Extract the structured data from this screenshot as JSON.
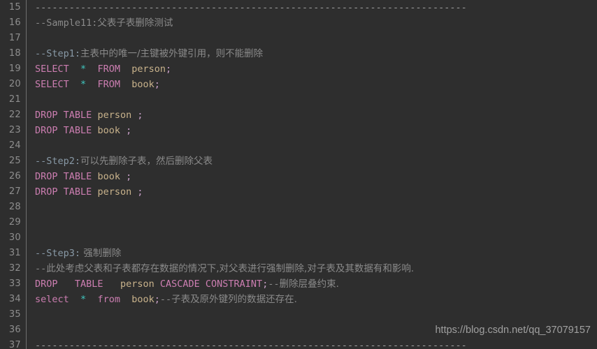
{
  "editor": {
    "theme": {
      "background": "#2e2e2e",
      "gutter_text": "#8e8e8e",
      "gutter_rule": "#6f6f6f",
      "default_text": "#a9b7c6",
      "keyword": "#cc7eb1",
      "identifier": "#c9b38c",
      "operator": "#40c8c0",
      "punctuation": "#c8a0c8",
      "comment": "#8a8a8a",
      "comment_label": "#8899a6"
    },
    "first_line_number": 15,
    "lines": [
      {
        "num": "15",
        "tokens": [
          {
            "cls": "dash",
            "t": "----------------------------------------------------------------------------"
          }
        ]
      },
      {
        "num": "16",
        "tokens": [
          {
            "cls": "cmt",
            "t": "--Sample11:"
          },
          {
            "cls": "cmt cjk",
            "t": "父表子表删除测试"
          }
        ]
      },
      {
        "num": "17",
        "tokens": []
      },
      {
        "num": "18",
        "tokens": [
          {
            "cls": "cmt-k",
            "t": "--Step1:"
          },
          {
            "cls": "cmt cjk",
            "t": "主表中的唯一/主键被外键引用，则不能删除"
          }
        ]
      },
      {
        "num": "19",
        "tokens": [
          {
            "cls": "kw",
            "t": "SELECT"
          },
          {
            "cls": "",
            "t": "  "
          },
          {
            "cls": "star",
            "t": "*"
          },
          {
            "cls": "",
            "t": "  "
          },
          {
            "cls": "kw",
            "t": "FROM"
          },
          {
            "cls": "",
            "t": "  "
          },
          {
            "cls": "id",
            "t": "person"
          },
          {
            "cls": "pun",
            "t": ";"
          }
        ]
      },
      {
        "num": "20",
        "tokens": [
          {
            "cls": "kw",
            "t": "SELECT"
          },
          {
            "cls": "",
            "t": "  "
          },
          {
            "cls": "star",
            "t": "*"
          },
          {
            "cls": "",
            "t": "  "
          },
          {
            "cls": "kw",
            "t": "FROM"
          },
          {
            "cls": "",
            "t": "  "
          },
          {
            "cls": "id",
            "t": "book"
          },
          {
            "cls": "pun",
            "t": ";"
          }
        ]
      },
      {
        "num": "21",
        "tokens": []
      },
      {
        "num": "22",
        "tokens": [
          {
            "cls": "kw",
            "t": "DROP"
          },
          {
            "cls": "",
            "t": " "
          },
          {
            "cls": "kw",
            "t": "TABLE"
          },
          {
            "cls": "",
            "t": " "
          },
          {
            "cls": "id",
            "t": "person"
          },
          {
            "cls": "",
            "t": " "
          },
          {
            "cls": "pun",
            "t": ";"
          }
        ]
      },
      {
        "num": "23",
        "tokens": [
          {
            "cls": "kw",
            "t": "DROP"
          },
          {
            "cls": "",
            "t": " "
          },
          {
            "cls": "kw",
            "t": "TABLE"
          },
          {
            "cls": "",
            "t": " "
          },
          {
            "cls": "id",
            "t": "book"
          },
          {
            "cls": "",
            "t": " "
          },
          {
            "cls": "pun",
            "t": ";"
          }
        ]
      },
      {
        "num": "24",
        "tokens": []
      },
      {
        "num": "25",
        "tokens": [
          {
            "cls": "cmt-k",
            "t": "--Step2:"
          },
          {
            "cls": "cmt cjk",
            "t": "可以先删除子表，然后删除父表"
          }
        ]
      },
      {
        "num": "26",
        "tokens": [
          {
            "cls": "kw",
            "t": "DROP"
          },
          {
            "cls": "",
            "t": " "
          },
          {
            "cls": "kw",
            "t": "TABLE"
          },
          {
            "cls": "",
            "t": " "
          },
          {
            "cls": "id",
            "t": "book"
          },
          {
            "cls": "",
            "t": " "
          },
          {
            "cls": "pun",
            "t": ";"
          }
        ]
      },
      {
        "num": "27",
        "tokens": [
          {
            "cls": "kw",
            "t": "DROP"
          },
          {
            "cls": "",
            "t": " "
          },
          {
            "cls": "kw",
            "t": "TABLE"
          },
          {
            "cls": "",
            "t": " "
          },
          {
            "cls": "id",
            "t": "person"
          },
          {
            "cls": "",
            "t": " "
          },
          {
            "cls": "pun",
            "t": ";"
          }
        ]
      },
      {
        "num": "28",
        "tokens": []
      },
      {
        "num": "29",
        "tokens": []
      },
      {
        "num": "30",
        "tokens": []
      },
      {
        "num": "31",
        "tokens": [
          {
            "cls": "cmt-k",
            "t": "--Step3:"
          },
          {
            "cls": "cmt cjk",
            "t": " 强制删除"
          }
        ]
      },
      {
        "num": "32",
        "tokens": [
          {
            "cls": "cmt",
            "t": "--"
          },
          {
            "cls": "cmt cjk",
            "t": "此处考虑父表和子表都存在数据的情况下,对父表进行强制删除,对子表及其数据有和影响."
          }
        ]
      },
      {
        "num": "33",
        "tokens": [
          {
            "cls": "kw",
            "t": "DROP"
          },
          {
            "cls": "",
            "t": "   "
          },
          {
            "cls": "kw",
            "t": "TABLE"
          },
          {
            "cls": "",
            "t": "   "
          },
          {
            "cls": "id",
            "t": "person"
          },
          {
            "cls": "",
            "t": " "
          },
          {
            "cls": "kw",
            "t": "CASCADE"
          },
          {
            "cls": "",
            "t": " "
          },
          {
            "cls": "kw",
            "t": "CONSTRAINT"
          },
          {
            "cls": "pun",
            "t": ";"
          },
          {
            "cls": "cmt",
            "t": "--"
          },
          {
            "cls": "cmt cjk",
            "t": "删除层叠约束."
          }
        ]
      },
      {
        "num": "34",
        "tokens": [
          {
            "cls": "kw",
            "t": "select"
          },
          {
            "cls": "",
            "t": "  "
          },
          {
            "cls": "star",
            "t": "*"
          },
          {
            "cls": "",
            "t": "  "
          },
          {
            "cls": "kw",
            "t": "from"
          },
          {
            "cls": "",
            "t": "  "
          },
          {
            "cls": "id",
            "t": "book"
          },
          {
            "cls": "pun",
            "t": ";"
          },
          {
            "cls": "cmt",
            "t": "--"
          },
          {
            "cls": "cmt cjk",
            "t": "子表及原外键列的数据还存在."
          }
        ]
      },
      {
        "num": "35",
        "tokens": []
      },
      {
        "num": "36",
        "tokens": []
      },
      {
        "num": "37",
        "tokens": [
          {
            "cls": "dash",
            "t": "----------------------------------------------------------------------------"
          }
        ]
      }
    ]
  },
  "watermark": {
    "text": "https://blog.csdn.net/qq_37079157"
  }
}
